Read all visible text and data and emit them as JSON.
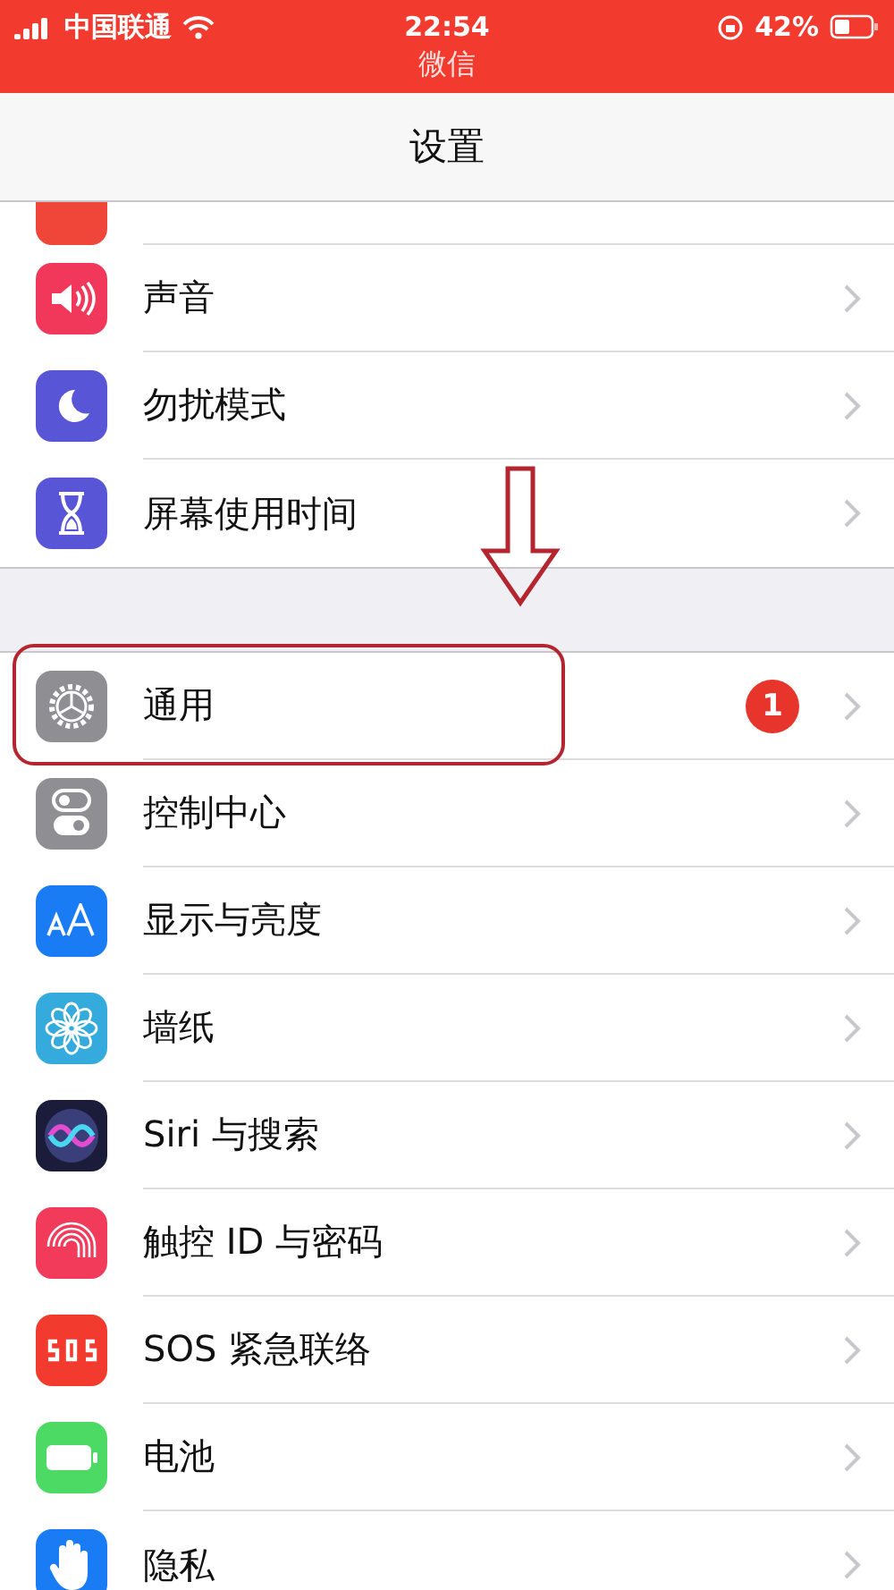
{
  "status_bar": {
    "carrier": "中国联通",
    "time": "22:54",
    "battery": "42%",
    "app_label": "微信"
  },
  "nav_bar": {
    "title": "设置"
  },
  "groups": [
    {
      "items": [
        {
          "kind": "notifications"
        },
        {
          "kind": "sound",
          "label": "声音"
        },
        {
          "kind": "moon",
          "label": "勿扰模式"
        },
        {
          "kind": "hourglass",
          "label": "屏幕使用时间"
        }
      ]
    },
    {
      "items": [
        {
          "kind": "gear",
          "label": "通用",
          "badge": "1",
          "highlighted": true
        },
        {
          "kind": "toggles",
          "label": "控制中心"
        },
        {
          "kind": "textsize",
          "label": "显示与亮度"
        },
        {
          "kind": "flower",
          "label": "墙纸"
        },
        {
          "kind": "siri",
          "label": "Siri 与搜索"
        },
        {
          "kind": "fingerprint",
          "label": "触控 ID 与密码"
        },
        {
          "kind": "sos",
          "label": "SOS 紧急联络"
        },
        {
          "kind": "battery",
          "label": "电池"
        },
        {
          "kind": "hand",
          "label": "隐私"
        }
      ]
    }
  ]
}
